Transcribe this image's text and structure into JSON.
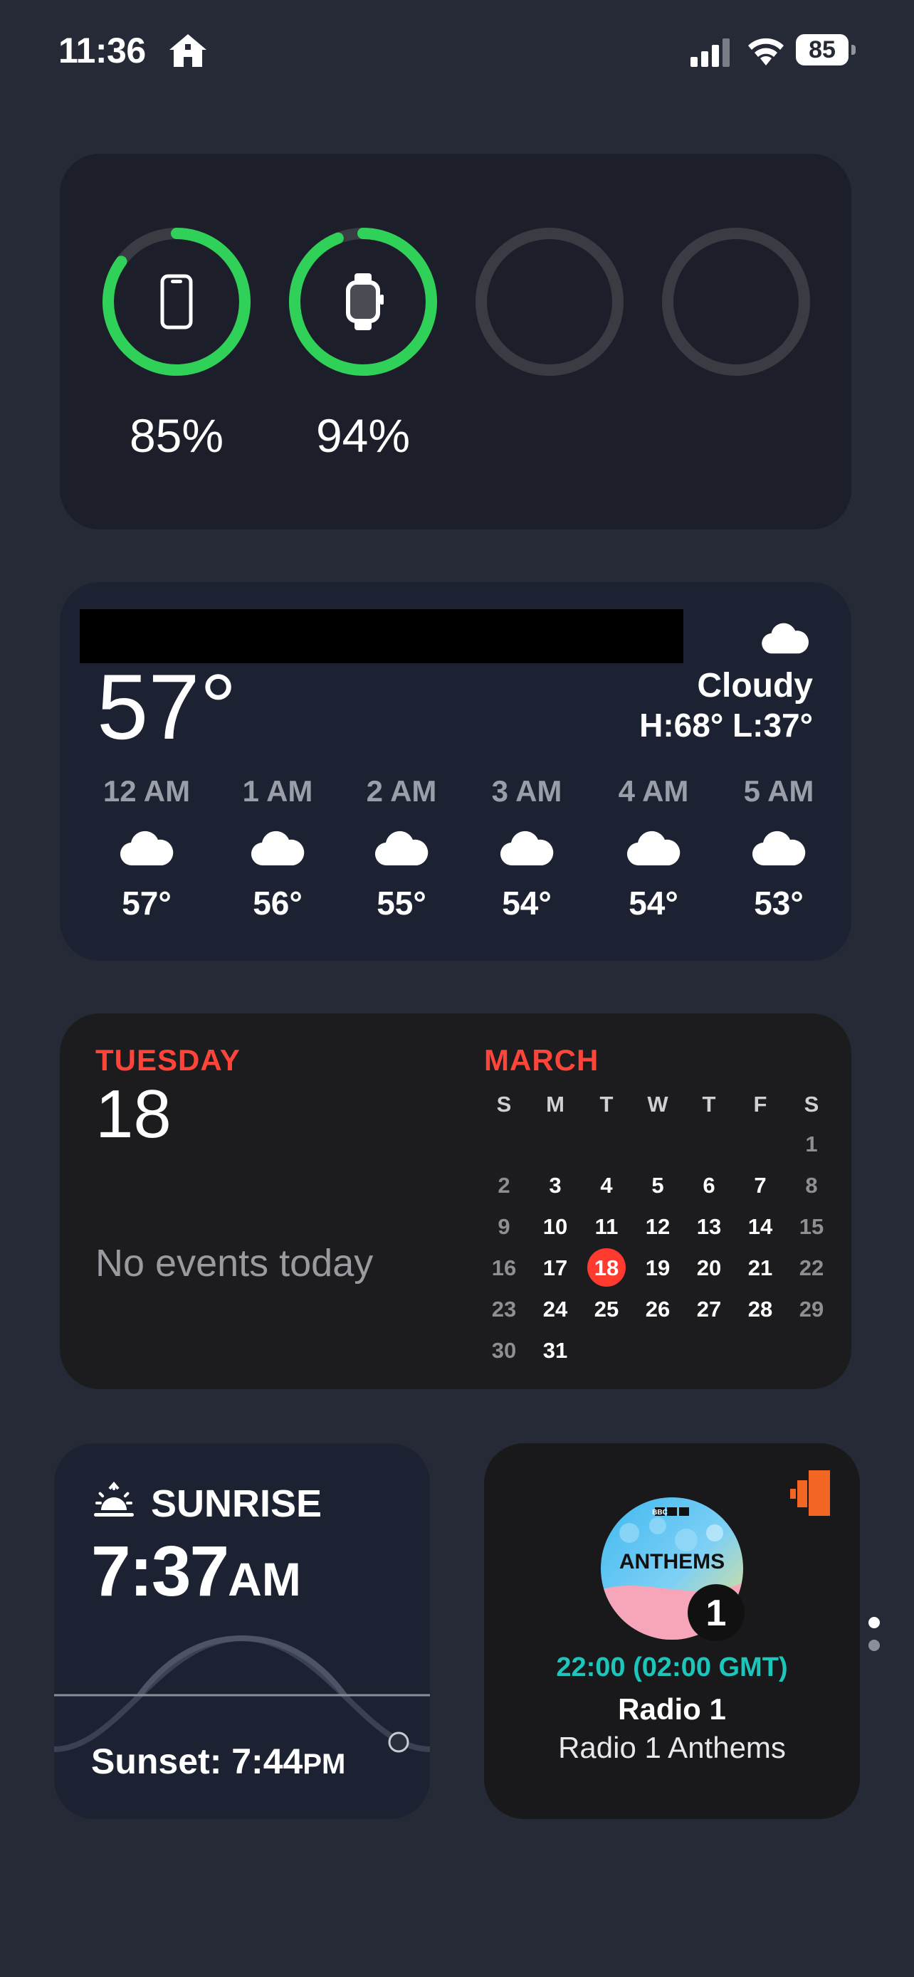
{
  "status_bar": {
    "time": "11:36",
    "battery": "85",
    "icons": [
      "home-icon",
      "signal-icon",
      "wifi-icon",
      "battery-icon"
    ]
  },
  "batteries": {
    "devices": [
      {
        "icon": "iphone-icon",
        "percent": 85,
        "label": "85%",
        "color": "#30d158"
      },
      {
        "icon": "watch-icon",
        "percent": 94,
        "label": "94%",
        "color": "#30d158"
      },
      {
        "icon": "",
        "percent": 0,
        "label": "",
        "color": "#3a3c44"
      },
      {
        "icon": "",
        "percent": 0,
        "label": "",
        "color": "#3a3c44"
      }
    ]
  },
  "weather": {
    "current_temp": "57°",
    "condition": "Cloudy",
    "high_low": "H:68° L:37°",
    "hours": [
      {
        "time": "12 AM",
        "temp": "57°",
        "icon": "cloud-icon"
      },
      {
        "time": "1 AM",
        "temp": "56°",
        "icon": "cloud-icon"
      },
      {
        "time": "2 AM",
        "temp": "55°",
        "icon": "cloud-icon"
      },
      {
        "time": "3 AM",
        "temp": "54°",
        "icon": "cloud-icon"
      },
      {
        "time": "4 AM",
        "temp": "54°",
        "icon": "cloud-icon"
      },
      {
        "time": "5 AM",
        "temp": "53°",
        "icon": "cloud-icon"
      }
    ]
  },
  "calendar": {
    "weekday": "TUESDAY",
    "day": "18",
    "no_events": "No events today",
    "month": "MARCH",
    "headers": [
      "S",
      "M",
      "T",
      "W",
      "T",
      "F",
      "S"
    ],
    "first_weekday": 6,
    "days_in_month": 31,
    "today": 18,
    "accent": "#ff3b30"
  },
  "sunrise": {
    "label": "SUNRISE",
    "time": "7:37",
    "time_suffix": "AM",
    "sunset_label": "Sunset: 7:44",
    "sunset_suffix": "PM"
  },
  "radio": {
    "art_text": "ANTHEMS",
    "art_brand": "BBC",
    "art_number": "1",
    "time": "22:00 (02:00 GMT)",
    "station": "Radio 1",
    "show": "Radio 1 Anthems"
  }
}
